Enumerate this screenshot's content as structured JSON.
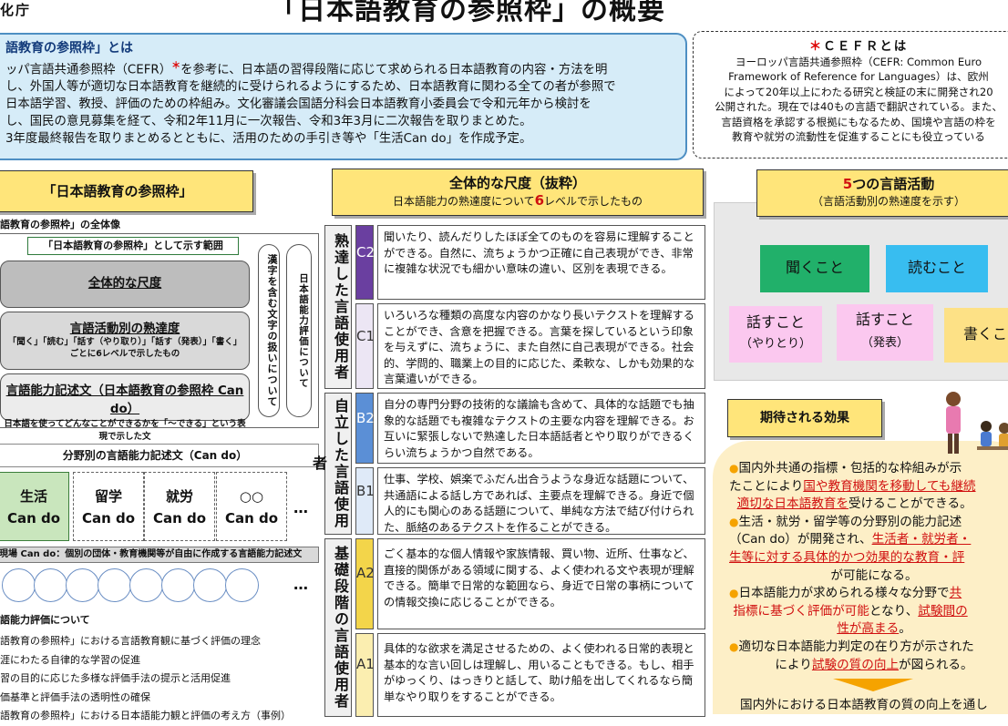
{
  "header": {
    "agency": "化庁",
    "title": "「日本語教育の参照枠」の概要"
  },
  "intro": {
    "heading": "語教育の参照枠」とは",
    "line1_a": "ッパ言語共通参照枠（CEFR）",
    "line1_ast": "＊",
    "line1_b": "を参考に、日本語の習得段階に応じて求められる日本語教育の内容・方法を明",
    "line2": "し、外国人等が適切な日本語教育を継続的に受けられるようにするため、日本語教育に関わる全ての者が参照で",
    "line3": "日本語学習、教授、評価のための枠組み。文化審議会国語分科会日本語教育小委員会で令和元年から検討を",
    "line4": "し、国民の意見募集を経て、令和2年11月に一次報告、令和3年3月に二次報告を取りまとめた。",
    "line5": "3年度最終報告を取りまとめるとともに、活用のための手引き等や「生活Can do」を作成予定。"
  },
  "cefr": {
    "title_ast": "＊",
    "title": "ＣＥＦＲとは",
    "lines": [
      "ヨーロッパ言語共通参照枠（CEFR: Common Euro",
      "Framework of Reference for Languages）は、欧州",
      "によって20年以上にわたる研究と検証の末に開発され20",
      "公開された。現在では40もの言語で翻訳されている。また、",
      "言語資格を承認する根拠にもなるため、国境や言語の枠を",
      "教育や就労の流動性を促進することにも役立っている"
    ]
  },
  "left": {
    "header": "「日本語教育の参照枠」",
    "caption": "語教育の参照枠」の全体像",
    "frame_tag": "「日本語教育の参照枠」として示す範囲",
    "box1": "全体的な尺度",
    "box2_title": "言語活動別の熟達度",
    "box2_sub1": "「聞く」「読む」「話す（やり取り）」「話す（発表）」「書く」",
    "box2_sub2": "ごとに6レベルで示したもの",
    "box3_title": "言語能力記述文（日本語教育の参照枠 Can do）",
    "box3_sub": "日本語を使ってどんなことができるかを「～できる」という表現で示した文",
    "pill1": "漢字を含む文字の扱いについて",
    "pill2": "日本語能力評価について",
    "domain_bar": "分野別の言語能力記述文（Can do）",
    "domains": [
      {
        "line1": "生活",
        "line2": "Can do"
      },
      {
        "line1": "留学",
        "line2": "Can do"
      },
      {
        "line1": "就労",
        "line2": "Can do"
      },
      {
        "line1": "○○",
        "line2": "Can do"
      }
    ],
    "ellipsis": "…",
    "genba": "現場 Can do：個別の団体・教育機関等が自由に作成する言語能力記述文",
    "eval_title": "語能力評価について",
    "eval_items": [
      "語教育の参照枠」における言語教育観に基づく評価の理念",
      "涯にわたる自律的な学習の促進",
      "習の目的に応じた多様な評価手法の提示と活用促進",
      "価基準と評価手法の透明性の確保",
      "語教育の参照枠」における日本語能力観と評価の考え方（事例）"
    ]
  },
  "middle": {
    "header_title": "全体的な尺度（抜粋）",
    "header_sub_a": "日本語能力の熟達度について",
    "header_sub_num": "6",
    "header_sub_b": "レベルで示したもの",
    "bands": [
      {
        "label": "熟達した言語使用者"
      },
      {
        "label": "自立した言語使用者"
      },
      {
        "label": "基礎段階の言語使用者"
      }
    ],
    "levels": [
      {
        "code": "C2",
        "text": "聞いたり、読んだりしたほぼ全てのものを容易に理解することができる。自然に、流ちょうかつ正確に自己表現ができ、非常に複雑な状況でも細かい意味の違い、区別を表現できる。"
      },
      {
        "code": "C1",
        "text": "いろいろな種類の高度な内容のかなり長いテクストを理解することができ、含意を把握できる。言葉を探しているという印象を与えずに、流ちょうに、また自然に自己表現ができる。社会的、学問的、職業上の目的に応じた、柔軟な、しかも効果的な言葉遣いができる。"
      },
      {
        "code": "B2",
        "text": "自分の専門分野の技術的な議論も含めて、具体的な話題でも抽象的な話題でも複雑なテクストの主要な内容を理解できる。お互いに緊張しないで熟達した日本語話者とやり取りができるくらい流ちょうかつ自然である。"
      },
      {
        "code": "B1",
        "text": "仕事、学校、娯楽でふだん出合うような身近な話題について、共通語による話し方であれば、主要点を理解できる。身近で個人的にも関心のある話題について、単純な方法で結び付けられた、脈絡のあるテクストを作ることができる。"
      },
      {
        "code": "A2",
        "text": "ごく基本的な個人情報や家族情報、買い物、近所、仕事など、直接的関係がある領域に関する、よく使われる文や表現が理解できる。簡単で日常的な範囲なら、身近で日常の事柄についての情報交換に応じることができる。"
      },
      {
        "code": "A1",
        "text": "具体的な欲求を満足させるための、よく使われる日常的表現と基本的な言い回しは理解し、用いることもできる。もし、相手がゆっくり、はっきりと話して、助け船を出してくれるなら簡単なやり取りをすることができる。"
      }
    ]
  },
  "right": {
    "header_num": "5",
    "header_title": "つの言語活動",
    "header_sub": "（言語活動別の熟達度を示す）",
    "activities": {
      "listen": "聞くこと",
      "read": "読むこと",
      "speak1_a": "話すこと",
      "speak1_b": "（やりとり）",
      "speak2_a": "話すこと",
      "speak2_b": "（発表）",
      "write": "書くこ"
    },
    "effect_header": "期待される効果",
    "effects": {
      "bullet": "●",
      "e1_a": "国内外共通の指標・包括的な枠組みが示",
      "e1_b": "たことにより",
      "e1_c": "国や教育機関を移動しても継続",
      "e1_d": "適切な日本語教育を",
      "e1_e": "受けることができる。",
      "e2_a": "生活・就労・留学等の分野別の能力記述",
      "e2_b": "（Can do）が開発され、",
      "e2_c": "生活者・就労者・",
      "e2_d": "生等に対する具体的かつ効果的な教育・評",
      "e2_e": "が可能になる。",
      "e3_a": "日本語能力が求められる様々な分野で",
      "e3_b": "共",
      "e3_c": "指標に基づく評価が可能",
      "e3_d": "となり、",
      "e3_e": "試験間の",
      "e3_f": "性が高まる",
      "e3_g": "。",
      "e4_a": "適切な日本語能力判定の在り方が示された",
      "e4_b": "により",
      "e4_c": "試験の質の向上",
      "e4_d": "が図られる。",
      "footer": "国内外における日本語教育の質の向上を通し"
    }
  },
  "colors": {
    "c_level": "#6a3fa0",
    "b_level": "#5b8fd6",
    "a_level": "#f3d54a",
    "accent_orange": "#f5a300",
    "red": "#d01010"
  }
}
